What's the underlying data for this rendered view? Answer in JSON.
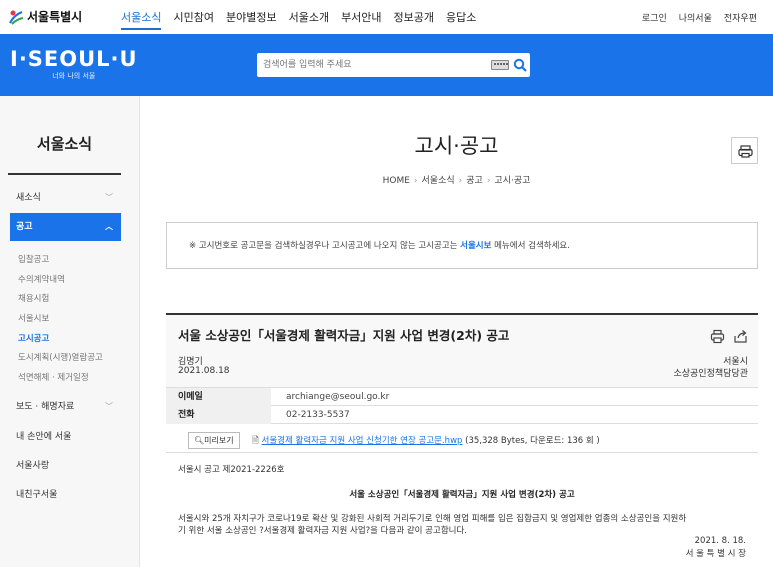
{
  "site": {
    "logo_text": "서울특별시",
    "brand": "I·SEOUL·U",
    "brand_sub": "너와 나의 서울"
  },
  "mainnav": [
    "서울소식",
    "시민참여",
    "분야별정보",
    "서울소개",
    "부서안내",
    "정보공개",
    "응답소"
  ],
  "utilnav": [
    "로그인",
    "나의서울",
    "전자우편"
  ],
  "search": {
    "placeholder": "검색어를 입력해 주세요"
  },
  "sidebar": {
    "title": "서울소식",
    "items": [
      {
        "label": "새소식"
      },
      {
        "label": "공고"
      },
      {
        "label": "보도 · 해명자료"
      },
      {
        "label": "내 손안에 서울"
      },
      {
        "label": "서울사랑"
      },
      {
        "label": "내친구서울"
      }
    ],
    "subitems": [
      "입찰공고",
      "수의계약내역",
      "채용시험",
      "서울시보",
      "고시공고",
      "도시계획(시행)열람공고",
      "석면해체 · 제거일정"
    ]
  },
  "page": {
    "title": "고시·공고",
    "breadcrumb": [
      "HOME",
      "서울소식",
      "공고",
      "고시·공고"
    ]
  },
  "notice": {
    "prefix": "※ 고시번호로 공고문을 검색하실경우나 고시공고에 나오지 않는 고시공고는 ",
    "link": "서울시보",
    "suffix": " 메뉴에서 검색하세요."
  },
  "post": {
    "title": "서울 소상공인「서울경제 활력자금」지원 사업 변경(2차) 공고",
    "author": "김명기",
    "date": "2021.08.18",
    "dept1": "서울시",
    "dept2": "소상공인정책담당관",
    "email_label": "이메일",
    "email": "archiange@seoul.go.kr",
    "phone_label": "전화",
    "phone": "02-2133-5537",
    "preview_label": "미리보기",
    "file_name": "서울경제 활력자금 지원 사업 신청기한 연장 공고문.hwp",
    "file_meta": " (35,328 Bytes, 다운로드: 136 회 )",
    "notice_no": "서울시 공고 제2021-2226호",
    "body_title": "서울 소상공인「서울경제 활력자금」지원 사업 변경(2차) 공고",
    "body_line1": "서울시와 25개 자치구가 코로나19로 확산 및 강화된 사회적 거리두기로 인해 영업 피해를 입은 집합금지 및 영업제한 업종의 소상공인을 지원하",
    "body_line2": "기 위한 서울 소상공인 ?서울경제 활력자금 지원 사업?을 다음과 같이 공고합니다.",
    "sign_date": "2021. 8. 18.",
    "sign_name": "서 울 특 별 시 장"
  },
  "colors": {
    "brand_blue": "#1a73e8",
    "sidebar_bg": "#f7f7f7"
  }
}
